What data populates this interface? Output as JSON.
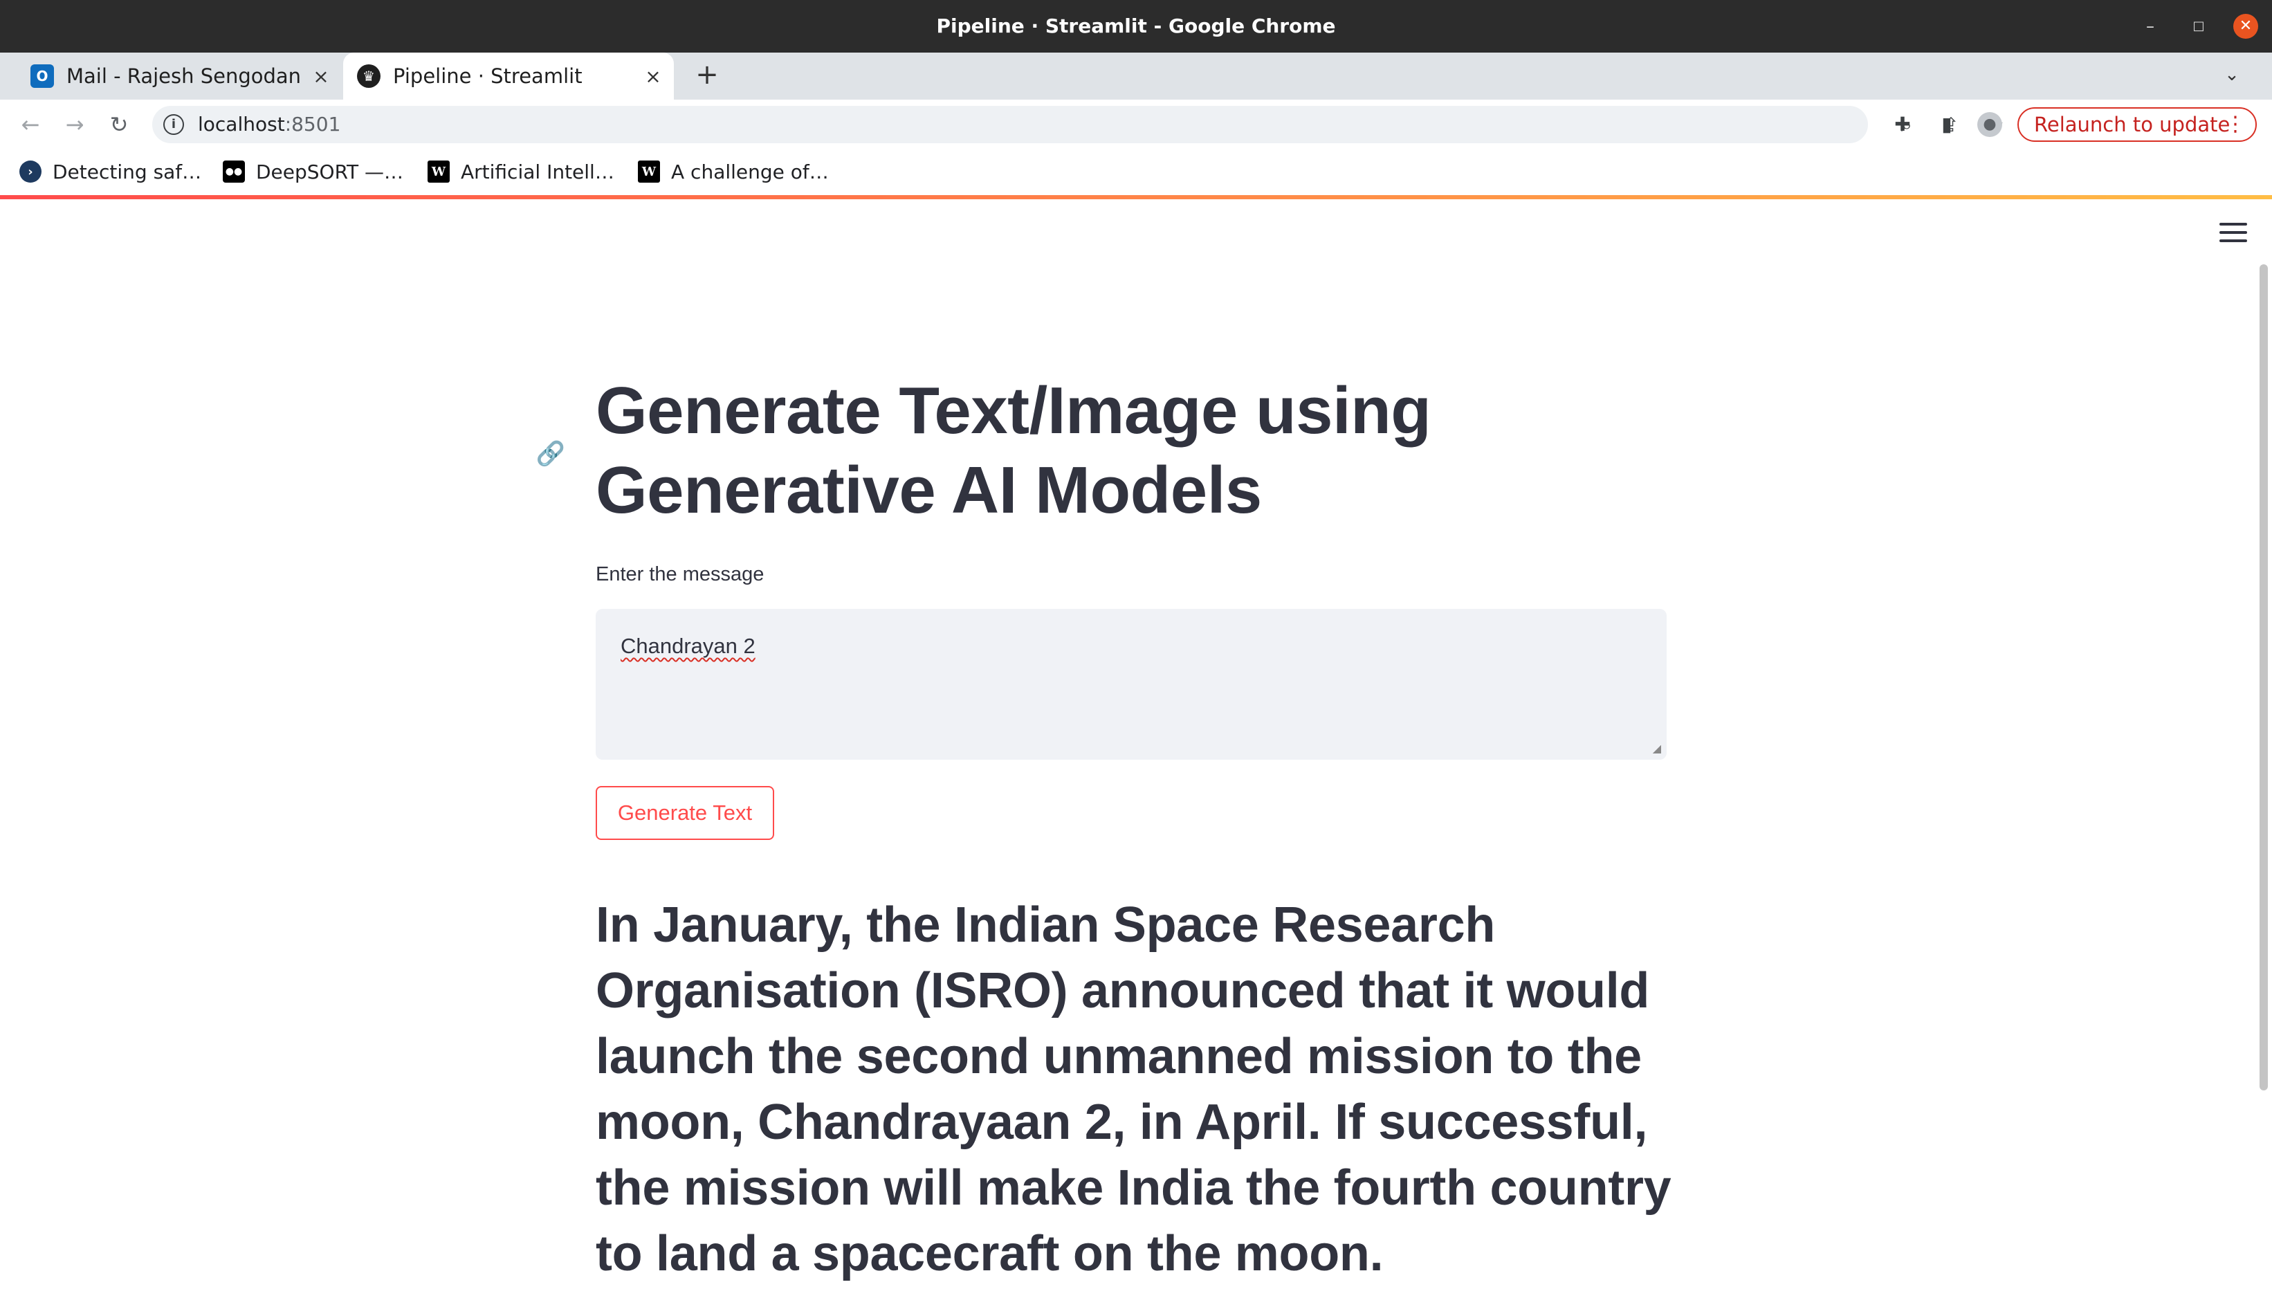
{
  "window": {
    "title": "Pipeline · Streamlit - Google Chrome",
    "minimize_icon": "–",
    "maximize_icon": "□",
    "close_icon": "✕"
  },
  "tabs": [
    {
      "label": "Mail - Rajesh Sengodan - O",
      "favicon": "outlook-icon",
      "favicon_text": "O",
      "close": "×",
      "active": false
    },
    {
      "label": "Pipeline · Streamlit",
      "favicon": "streamlit-icon",
      "favicon_text": "♛",
      "close": "×",
      "active": true
    }
  ],
  "tabstrip": {
    "new_tab": "+",
    "tab_menu": "⌄"
  },
  "toolbar": {
    "back": "←",
    "forward": "→",
    "reload": "↻",
    "url_host": "localhost",
    "url_port": ":8501",
    "info_icon": "i",
    "zoom_icon": "⌕",
    "share_icon": "⇪",
    "star_icon": "☆",
    "extensions_icon": "✚",
    "sidepanel_icon": "▮",
    "profile_icon": "●",
    "relaunch_label": "Relaunch to update",
    "menu_icon": "⋮"
  },
  "bookmarks": [
    {
      "label": "Detecting saf…",
      "icon_text": "›"
    },
    {
      "label": "DeepSORT —…",
      "icon_text": "●●"
    },
    {
      "label": "Artificial Intell…",
      "icon_text": "W"
    },
    {
      "label": "A challenge of…",
      "icon_text": "W"
    }
  ],
  "page": {
    "title": "Generate Text/Image using Generative AI Models",
    "anchor_icon": "🔗",
    "input_label": "Enter the message",
    "input_value": "Chandrayan 2",
    "button_label": "Generate Text",
    "output_text": "In January, the Indian Space Research Organisation (ISRO) announced that it would launch the second unmanned mission to the moon, Chandrayaan 2, in April. If successful, the mission will make India the fourth country to land a spacecraft on the moon."
  },
  "colors": {
    "accent": "#ff4b4b",
    "text": "#31333f",
    "input_bg": "#f0f2f6",
    "relaunch": "#c5221f"
  }
}
